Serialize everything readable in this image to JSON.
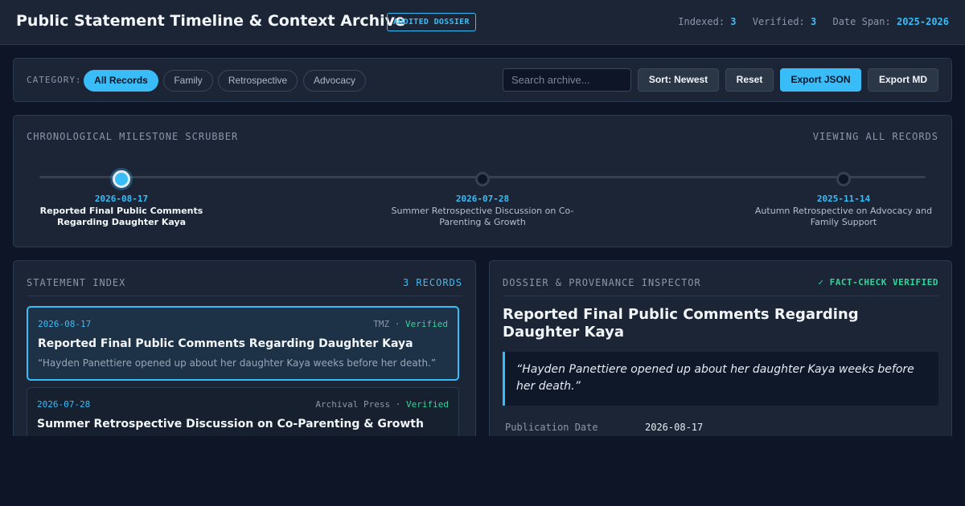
{
  "header": {
    "title": "Public Statement Timeline & Context Archive",
    "badge": "AUDITED DOSSIER",
    "stats": [
      {
        "label": "Indexed:",
        "value": "3"
      },
      {
        "label": "Verified:",
        "value": "3"
      },
      {
        "label": "Date Span:",
        "value": "2025-2026"
      }
    ]
  },
  "filters": {
    "category_label": "CATEGORY:",
    "chips": [
      "All Records",
      "Family",
      "Retrospective",
      "Advocacy"
    ],
    "active_chip": "All Records",
    "search_placeholder": "Search archive...",
    "search_value": "",
    "buttons": {
      "sort": "Sort: Newest",
      "reset": "Reset",
      "export_json": "Export JSON",
      "export_md": "Export MD"
    }
  },
  "scrubber": {
    "title": "CHRONOLOGICAL MILESTONE SCRUBBER",
    "status": "VIEWING ALL RECORDS",
    "milestones": [
      {
        "date": "2026-08-17",
        "title": "Reported Final Public Comments Regarding Daughter Kaya",
        "active": true
      },
      {
        "date": "2026-07-28",
        "title": "Summer Retrospective Discussion on Co-Parenting & Growth",
        "active": false
      },
      {
        "date": "2025-11-14",
        "title": "Autumn Retrospective on Advocacy and Family Support",
        "active": false
      }
    ]
  },
  "index": {
    "title": "STATEMENT INDEX",
    "count": "3 RECORDS",
    "separator": "·",
    "records": [
      {
        "date": "2026-08-17",
        "source": "TMZ",
        "status": "Verified",
        "title": "Reported Final Public Comments Regarding Daughter Kaya",
        "excerpt": "“Hayden Panettiere opened up about her daughter Kaya weeks before her death.”",
        "selected": true
      },
      {
        "date": "2026-07-28",
        "source": "Archival Press",
        "status": "Verified",
        "title": "Summer Retrospective Discussion on Co-Parenting & Growth",
        "excerpt": "",
        "selected": false
      }
    ]
  },
  "inspector": {
    "title": "DOSSIER & PROVENANCE INSPECTOR",
    "badge": "✓ FACT-CHECK VERIFIED",
    "record_title": "Reported Final Public Comments Regarding Daughter Kaya",
    "quote": "“Hayden Panettiere opened up about her daughter Kaya weeks before her death.”",
    "meta": [
      {
        "label": "Publication Date",
        "value": "2026-08-17"
      }
    ]
  },
  "colors": {
    "accent": "#38bdf8",
    "verified": "#34d399",
    "background": "#0d1526",
    "panel": "#1b2536"
  }
}
